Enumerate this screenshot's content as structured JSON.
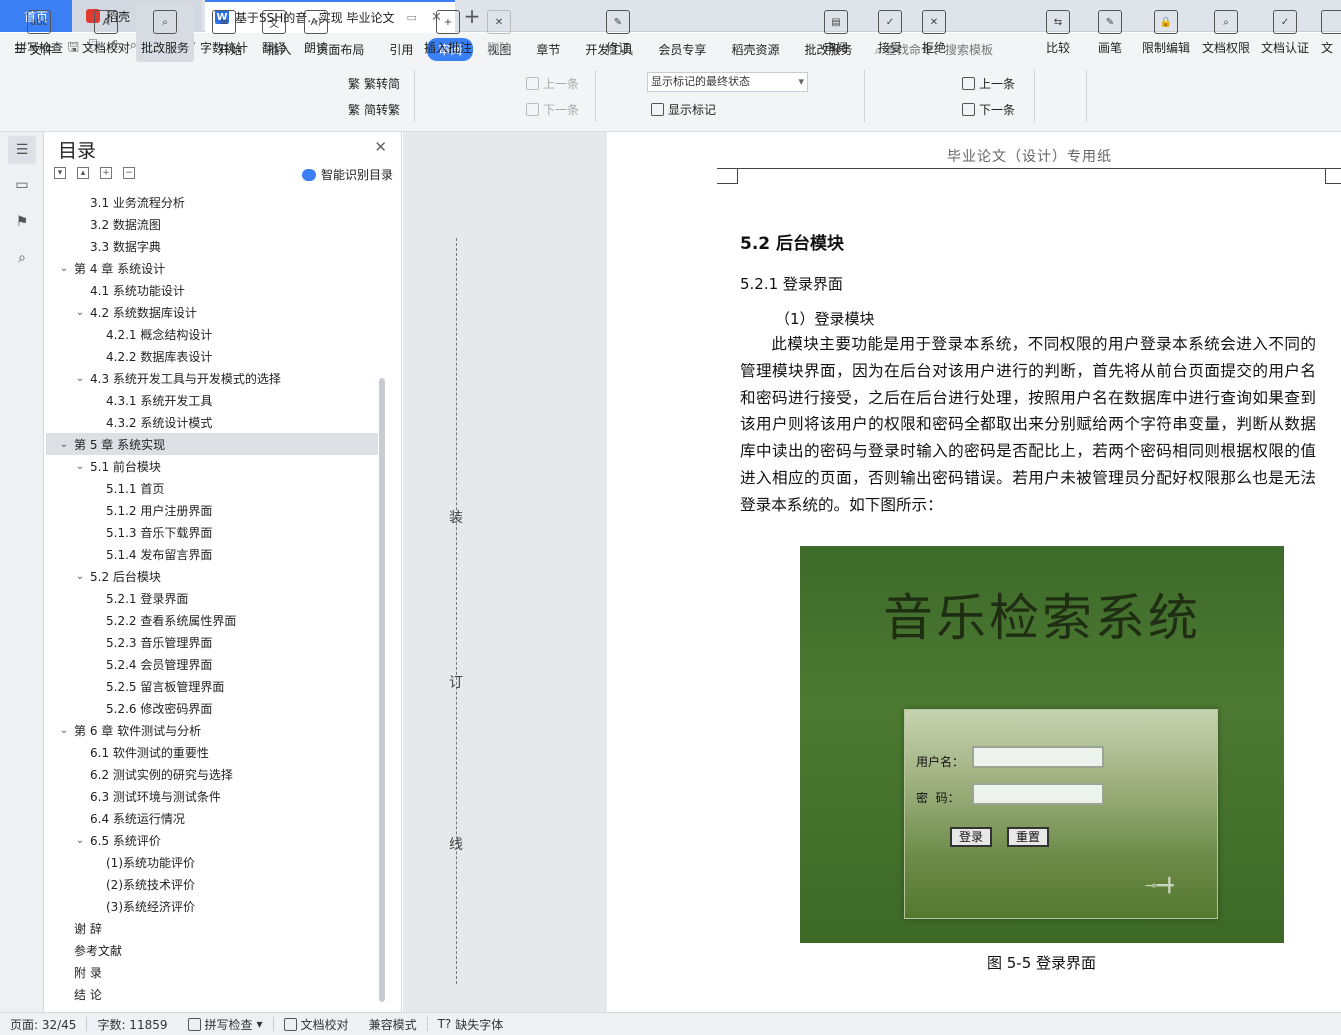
{
  "tabs": {
    "home": "首页",
    "daoke": "稻壳",
    "doc": "基于SSH的音...实现 毕业论文",
    "add": "+"
  },
  "menubar": {
    "file": "文件",
    "items": [
      "开始",
      "插入",
      "页面布局",
      "引用",
      "审阅",
      "视图",
      "章节",
      "开发工具",
      "会员专享",
      "稻壳资源",
      "批改服务"
    ],
    "active": "审阅",
    "search": "查找命令、搜索模板"
  },
  "ribbon": {
    "spell": "拼写检查",
    "proof": "文档校对",
    "revise": "批改服务",
    "count": "字数统计",
    "translate": "翻译",
    "read": "朗读",
    "to_trad": "繁转简",
    "to_simp": "简转繁",
    "insert_comment": "插入批注",
    "delete": "删除",
    "prev": "上一条",
    "next": "下一条",
    "track": "修订",
    "markup_state": "显示标记的最终状态",
    "show_markup": "显示标记",
    "review": "审阅",
    "accept": "接受",
    "reject": "拒绝",
    "prev2": "上一条",
    "next2": "下一条",
    "compare": "比较",
    "pen": "画笔",
    "restrict": "限制编辑",
    "rights": "文档权限",
    "certify": "文档认证",
    "more": "文"
  },
  "toc": {
    "title": "目录",
    "ai_label": "智能识别目录",
    "items": [
      {
        "text": "3.1  业务流程分析",
        "level": 2,
        "arrow": ""
      },
      {
        "text": "3.2  数据流图",
        "level": 2,
        "arrow": ""
      },
      {
        "text": "3.3  数据字典",
        "level": 2,
        "arrow": ""
      },
      {
        "text": "第 4 章  系统设计",
        "level": 1,
        "arrow": "v"
      },
      {
        "text": "4.1  系统功能设计",
        "level": 2,
        "arrow": ""
      },
      {
        "text": "4.2  系统数据库设计",
        "level": 2,
        "arrow": "v"
      },
      {
        "text": "4.2.1  概念结构设计",
        "level": 3,
        "arrow": ""
      },
      {
        "text": "4.2.2  数据库表设计",
        "level": 3,
        "arrow": ""
      },
      {
        "text": "4.3  系统开发工具与开发模式的选择",
        "level": 2,
        "arrow": "v"
      },
      {
        "text": "4.3.1  系统开发工具",
        "level": 3,
        "arrow": ""
      },
      {
        "text": "4.3.2  系统设计模式",
        "level": 3,
        "arrow": ""
      },
      {
        "text": "第 5 章  系统实现",
        "level": 1,
        "arrow": "v",
        "highlight": true
      },
      {
        "text": "5.1  前台模块",
        "level": 2,
        "arrow": "v"
      },
      {
        "text": "5.1.1  首页",
        "level": 3,
        "arrow": ""
      },
      {
        "text": "5.1.2  用户注册界面",
        "level": 3,
        "arrow": ""
      },
      {
        "text": "5.1.3  音乐下载界面",
        "level": 3,
        "arrow": ""
      },
      {
        "text": "5.1.4  发布留言界面",
        "level": 3,
        "arrow": ""
      },
      {
        "text": "5.2  后台模块",
        "level": 2,
        "arrow": "v"
      },
      {
        "text": "5.2.1  登录界面",
        "level": 3,
        "arrow": ""
      },
      {
        "text": "5.2.2  查看系统属性界面",
        "level": 3,
        "arrow": ""
      },
      {
        "text": "5.2.3  音乐管理界面",
        "level": 3,
        "arrow": ""
      },
      {
        "text": "5.2.4  会员管理界面",
        "level": 3,
        "arrow": ""
      },
      {
        "text": "5.2.5  留言板管理界面",
        "level": 3,
        "arrow": ""
      },
      {
        "text": "5.2.6  修改密码界面",
        "level": 3,
        "arrow": ""
      },
      {
        "text": "第 6 章  软件测试与分析",
        "level": 1,
        "arrow": "v"
      },
      {
        "text": "6.1  软件测试的重要性",
        "level": 2,
        "arrow": ""
      },
      {
        "text": "6.2  测试实例的研究与选择",
        "level": 2,
        "arrow": ""
      },
      {
        "text": "6.3  测试环境与测试条件",
        "level": 2,
        "arrow": ""
      },
      {
        "text": "6.4  系统运行情况",
        "level": 2,
        "arrow": ""
      },
      {
        "text": "6.5  系统评价",
        "level": 2,
        "arrow": "v"
      },
      {
        "text": "(1)系统功能评价",
        "level": 3,
        "arrow": ""
      },
      {
        "text": "(2)系统技术评价",
        "level": 3,
        "arrow": ""
      },
      {
        "text": "(3)系统经济评价",
        "level": 3,
        "arrow": ""
      },
      {
        "text": "谢    辞",
        "level": 1,
        "arrow": ""
      },
      {
        "text": "参考文献",
        "level": 1,
        "arrow": ""
      },
      {
        "text": "附    录",
        "level": 1,
        "arrow": ""
      },
      {
        "text": "结    论",
        "level": 1,
        "arrow": ""
      }
    ]
  },
  "page": {
    "header": "毕业论文（设计）专用纸",
    "binding": [
      "装",
      "订",
      "线"
    ],
    "h2": "5.2  后台模块",
    "h3": "5.2.1  登录界面",
    "sub": "（1）登录模块",
    "para": "此模块主要功能是用于登录本系统，不同权限的用户登录本系统会进入不同的管理模块界面，因为在后台对该用户进行的判断，首先将从前台页面提交的用户名和密码进行接受，之后在后台进行处理，按照用户名在数据库中进行查询如果查到该用户则将该用户的权限和密码全都取出来分别赋给两个字符串变量，判断从数据库中读出的密码与登录时输入的密码是否配比上，若两个密码相同则根据权限的值进入相应的页面，否则输出密码错误。若用户未被管理员分配好权限那么也是无法登录本系统的。如下图所示：",
    "figure": {
      "title": "音乐检索系统",
      "user_label": "用户名：",
      "pwd_label": "密  码：",
      "login_btn": "登录",
      "reset_btn": "重置"
    },
    "caption": "图 5-5 登录界面"
  },
  "status": {
    "page": "页面: 32/45",
    "words": "字数: 11859",
    "spell": "拼写检查",
    "proof": "文档校对",
    "compat": "兼容模式",
    "font": "缺失字体"
  }
}
